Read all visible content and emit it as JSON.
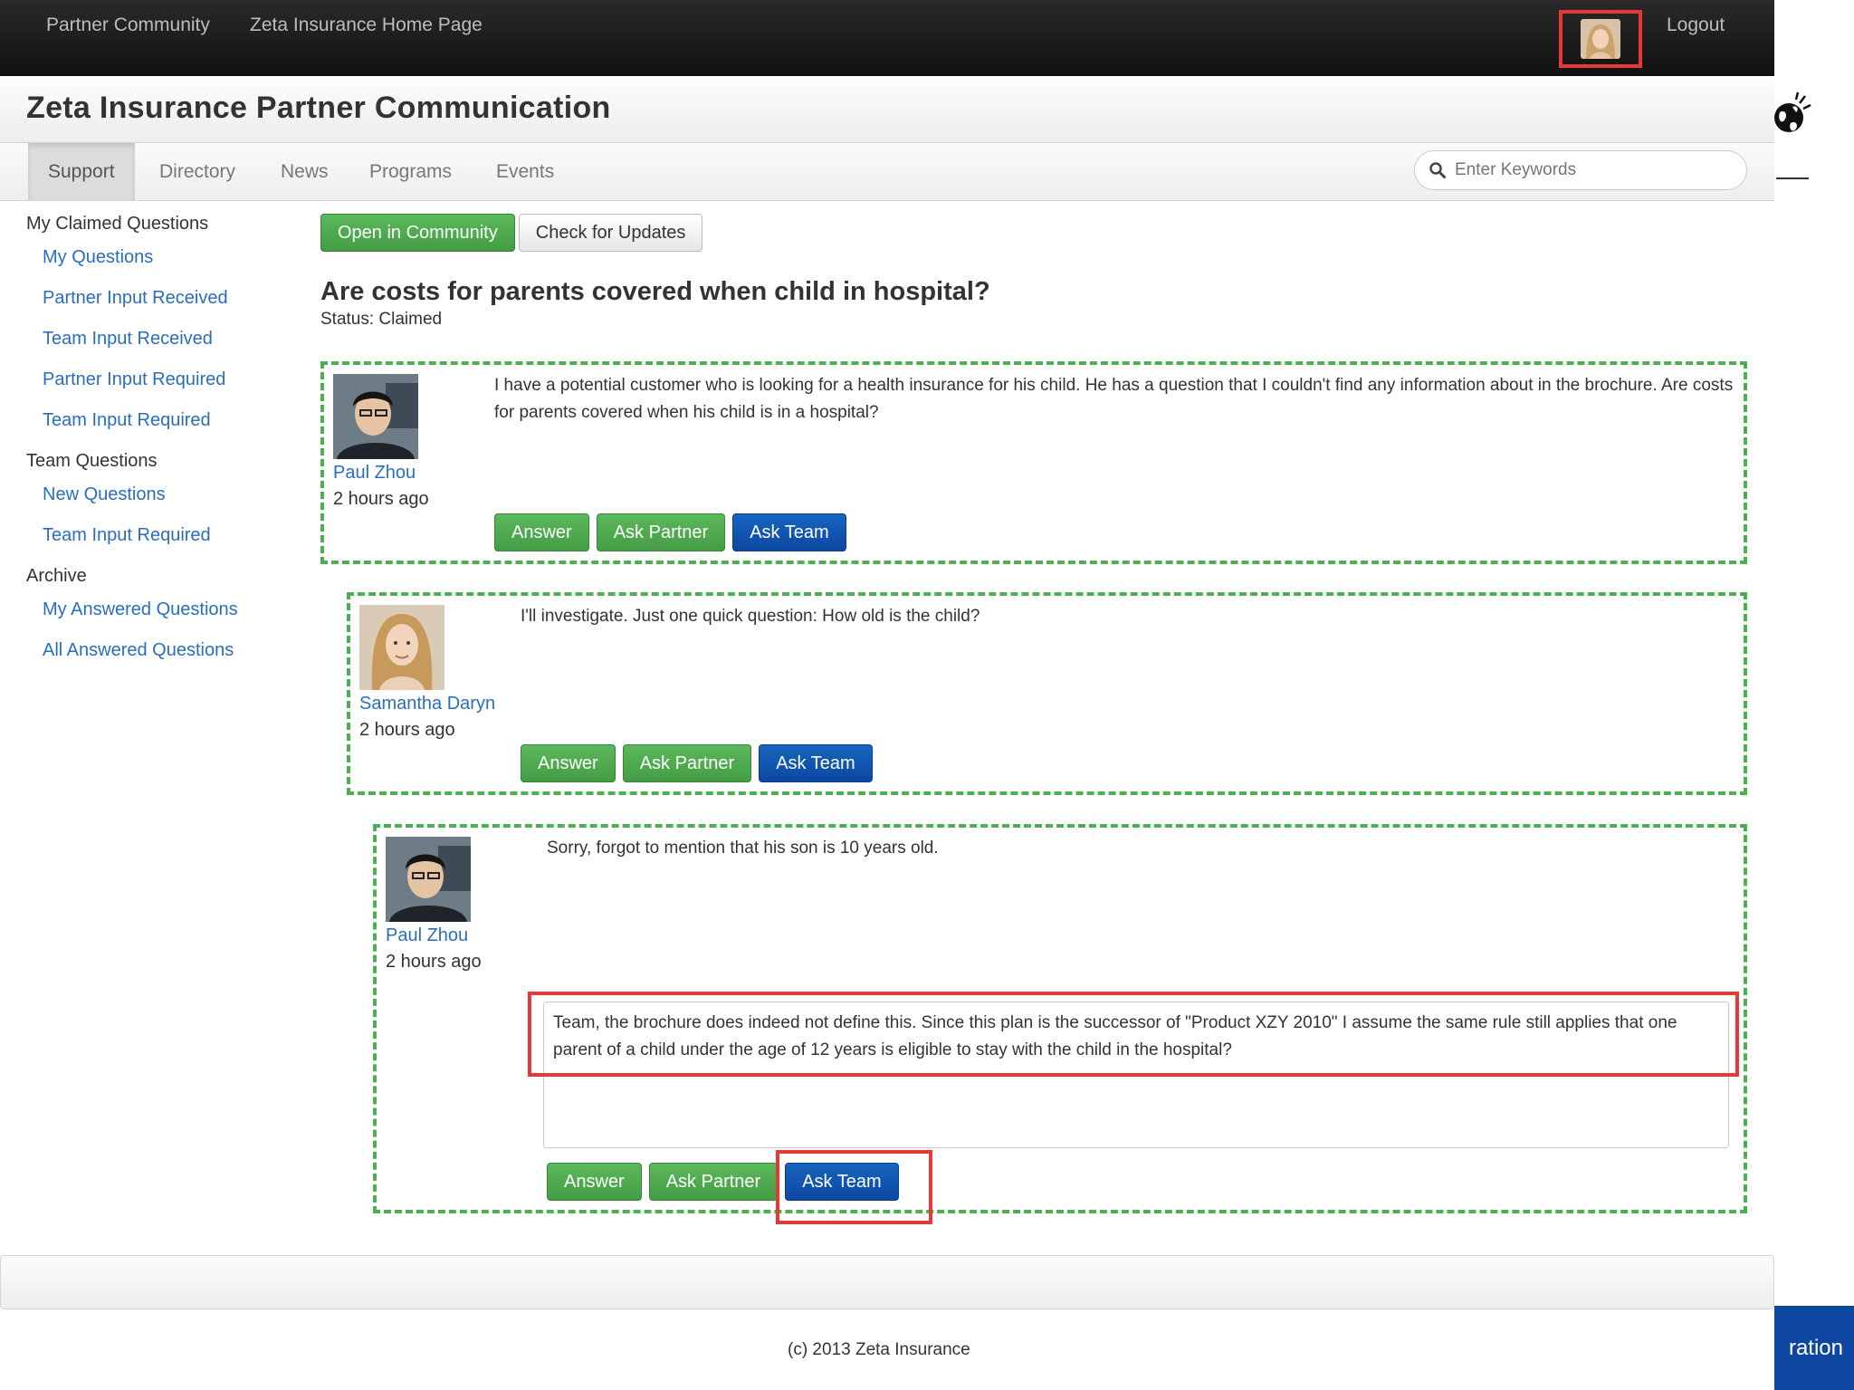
{
  "topbar": {
    "links": [
      "Partner Community",
      "Zeta Insurance Home Page"
    ],
    "logout": "Logout"
  },
  "header": {
    "title": "Zeta Insurance Partner Communication"
  },
  "tabs": [
    "Support",
    "Directory",
    "News",
    "Programs",
    "Events"
  ],
  "search": {
    "placeholder": "Enter Keywords"
  },
  "sidebar": {
    "groups": [
      {
        "heading": "My Claimed Questions",
        "items": [
          "My Questions",
          "Partner Input Received",
          "Team Input Received",
          "Partner Input Required",
          "Team Input Required"
        ]
      },
      {
        "heading": "Team Questions",
        "items": [
          "New Questions",
          "Team Input Required"
        ]
      },
      {
        "heading": "Archive",
        "items": [
          "My Answered Questions",
          "All Answered Questions"
        ]
      }
    ]
  },
  "actions": {
    "open": "Open in Community",
    "check": "Check for Updates"
  },
  "question": {
    "title": "Are costs for parents covered when child in hospital?",
    "status": "Status: Claimed"
  },
  "posts": [
    {
      "author": "Paul Zhou",
      "time": "2 hours ago",
      "text": "I have a potential customer who is looking for a health insurance for his child. He has a question that I couldn't find any information about in the brochure. Are costs for parents covered when his child is in a hospital?"
    },
    {
      "author": "Samantha Daryn",
      "time": "2 hours ago",
      "text": "I'll investigate. Just one quick question: How old is the child?"
    },
    {
      "author": "Paul Zhou",
      "time": "2 hours ago",
      "text": "Sorry, forgot to mention that his son is 10 years old."
    }
  ],
  "post_buttons": {
    "answer": "Answer",
    "ask_partner": "Ask Partner",
    "ask_team": "Ask Team"
  },
  "reply": {
    "text": "Team, the brochure does indeed not define this. Since this plan is the successor of \"Product XZY 2010\" I assume the same rule still applies that one parent of a child under the age of 12 years is eligible to stay with the child in the hospital?"
  },
  "footer": {
    "copyright": "(c) 2013 Zeta Insurance"
  },
  "right_edge": {
    "fragment": "ration"
  }
}
